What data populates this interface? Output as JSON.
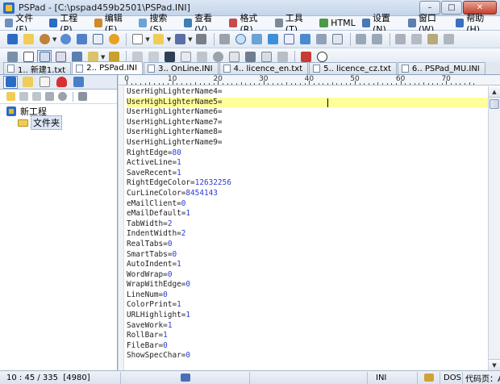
{
  "window": {
    "title": "PSPad - [C:\\pspad459b2501\\PSPad.INI]",
    "buttons": {
      "minimize": "–",
      "maximize": "□",
      "close": "✕"
    }
  },
  "menu": {
    "items": [
      {
        "label": "文件(F)",
        "icon": "file-menu-icon",
        "color": "#6f8fbf"
      },
      {
        "label": "工程(P)",
        "icon": "project-menu-icon",
        "color": "#2b6bc4"
      },
      {
        "label": "编辑(E)",
        "icon": "edit-menu-icon",
        "color": "#d08a2a"
      },
      {
        "label": "搜索(S)",
        "icon": "search-menu-icon",
        "color": "#6aa3d6"
      },
      {
        "label": "查看(V)",
        "icon": "view-menu-icon",
        "color": "#3d7fb5"
      },
      {
        "label": "格式(R)",
        "icon": "format-menu-icon",
        "color": "#c94a4a"
      },
      {
        "label": "工具(T)",
        "icon": "tools-menu-icon",
        "color": "#7b8a9a"
      },
      {
        "label": "HTML",
        "icon": "html-menu-icon",
        "color": "#4a9a4a"
      },
      {
        "label": "设置(N)",
        "icon": "settings-menu-icon",
        "color": "#4b77b5"
      },
      {
        "label": "窗口(W)",
        "icon": "window-menu-icon",
        "color": "#5a7fb0"
      },
      {
        "label": "帮助(H)",
        "icon": "help-menu-icon",
        "color": "#3b6fc0"
      }
    ]
  },
  "tabs": [
    {
      "label": "1.. 新建1.txt",
      "active": false
    },
    {
      "label": "2.. PSPad.INI",
      "active": true
    },
    {
      "label": "3.. OnLine.INI",
      "active": false
    },
    {
      "label": "4.. licence_en.txt",
      "active": false
    },
    {
      "label": "5.. licence_cz.txt",
      "active": false
    },
    {
      "label": "6.. PSPad_MU.INI",
      "active": false
    }
  ],
  "sidebar": {
    "tree": {
      "root_label": "新工程",
      "child_label": "文件夹"
    }
  },
  "ruler": {
    "labels": [
      "0",
      "10",
      "20",
      "30",
      "40",
      "50",
      "60",
      "70"
    ]
  },
  "editor": {
    "highlight_line": 2,
    "lines": [
      {
        "key": "UserHighLighterName4",
        "value": ""
      },
      {
        "key": "UserHighLighterName5",
        "value": ""
      },
      {
        "key": "UserHighLighterName6",
        "value": ""
      },
      {
        "key": "UserHighLighterName7",
        "value": ""
      },
      {
        "key": "UserHighLighterName8",
        "value": ""
      },
      {
        "key": "UserHighLighterName9",
        "value": ""
      },
      {
        "key": "RightEdge",
        "value": "80"
      },
      {
        "key": "ActiveLine",
        "value": "1"
      },
      {
        "key": "SaveRecent",
        "value": "1"
      },
      {
        "key": "RightEdgeColor",
        "value": "12632256"
      },
      {
        "key": "CurLineColor",
        "value": "8454143"
      },
      {
        "key": "eMailClient",
        "value": "0"
      },
      {
        "key": "eMailDefault",
        "value": "1"
      },
      {
        "key": "TabWidth",
        "value": "2"
      },
      {
        "key": "IndentWidth",
        "value": "2"
      },
      {
        "key": "RealTabs",
        "value": "0"
      },
      {
        "key": "SmartTabs",
        "value": "0"
      },
      {
        "key": "AutoIndent",
        "value": "1"
      },
      {
        "key": "WordWrap",
        "value": "0"
      },
      {
        "key": "WrapWithEdge",
        "value": "0"
      },
      {
        "key": "LineNum",
        "value": "0"
      },
      {
        "key": "ColorPrint",
        "value": "1"
      },
      {
        "key": "URLHighlight",
        "value": "1"
      },
      {
        "key": "SaveWork",
        "value": "1"
      },
      {
        "key": "RollBar",
        "value": "1"
      },
      {
        "key": "FileBar",
        "value": "0"
      },
      {
        "key": "ShowSpecChar",
        "value": "0"
      }
    ]
  },
  "status": {
    "position": "10 : 45 / 335",
    "code": "[4980]",
    "syntax": "INI",
    "eol": "DOS",
    "encoding": "代码页：A"
  },
  "colors": {
    "value_blue": "#2b3cd6",
    "current_line": "#ffff99",
    "folder": "#f0cd57"
  }
}
